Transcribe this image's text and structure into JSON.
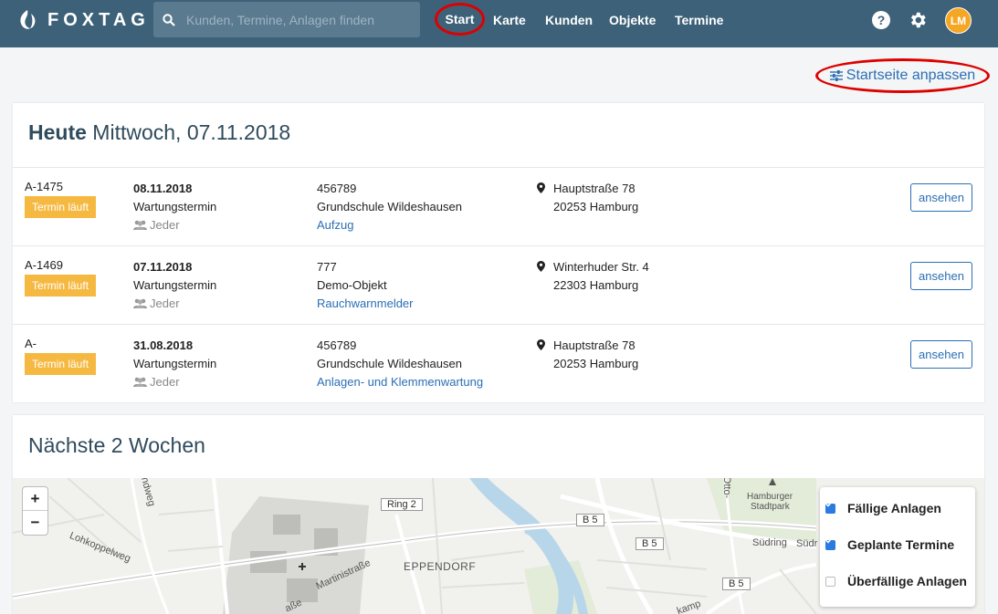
{
  "app": {
    "brand": "FOXTAG",
    "search_placeholder": "Kunden, Termine, Anlagen finden",
    "nav": [
      "Start",
      "Karte",
      "Kunden",
      "Objekte",
      "Termine"
    ],
    "active_nav": "Start",
    "help_label": "?",
    "avatar_initials": "LM",
    "colors": {
      "topbar": "#3d6179",
      "accent": "#2a6fb5",
      "badge": "#f5b942",
      "avatar": "#f5a623"
    }
  },
  "customize_label": "Startseite anpassen",
  "today": {
    "title_bold": "Heute",
    "title_rest": "Mittwoch, 07.11.2018",
    "rows": [
      {
        "id": "A-1475",
        "status": "Termin läuft",
        "date": "08.11.2018",
        "type": "Wartungstermin",
        "assignee": "Jeder",
        "object_no": "456789",
        "object_name": "Grundschule Wildeshausen",
        "system": "Aufzug",
        "street": "Hauptstraße 78",
        "city": "20253 Hamburg",
        "action": "ansehen"
      },
      {
        "id": "A-1469",
        "status": "Termin läuft",
        "date": "07.11.2018",
        "type": "Wartungstermin",
        "assignee": "Jeder",
        "object_no": "777",
        "object_name": "Demo-Objekt",
        "system": "Rauchwarnmelder",
        "street": "Winterhuder Str. 4",
        "city": "22303 Hamburg",
        "action": "ansehen"
      },
      {
        "id": "A-",
        "status": "Termin läuft",
        "date": "31.08.2018",
        "type": "Wartungstermin",
        "assignee": "Jeder",
        "object_no": "456789",
        "object_name": "Grundschule Wildeshausen",
        "system": "Anlagen- und Klemmenwartung",
        "street": "Hauptstraße 78",
        "city": "20253 Hamburg",
        "action": "ansehen"
      }
    ]
  },
  "next": {
    "title": "Nächste 2 Wochen",
    "map": {
      "zoom_in": "+",
      "zoom_out": "−",
      "labels": [
        "andweg",
        "Lohkoppelweg",
        "Martinistraße",
        "EPPENDORF",
        "Hamburger",
        "Stadtpark",
        "Südring",
        "Südr",
        "kamp",
        "Otto-",
        "aße"
      ],
      "road_signs": [
        "Ring 2",
        "B 5",
        "B 5",
        "B 5"
      ],
      "legend": [
        {
          "label": "Fällige Anlagen",
          "checked": true
        },
        {
          "label": "Geplante Termine",
          "checked": true
        },
        {
          "label": "Überfällige Anlagen",
          "checked": false
        }
      ]
    }
  }
}
